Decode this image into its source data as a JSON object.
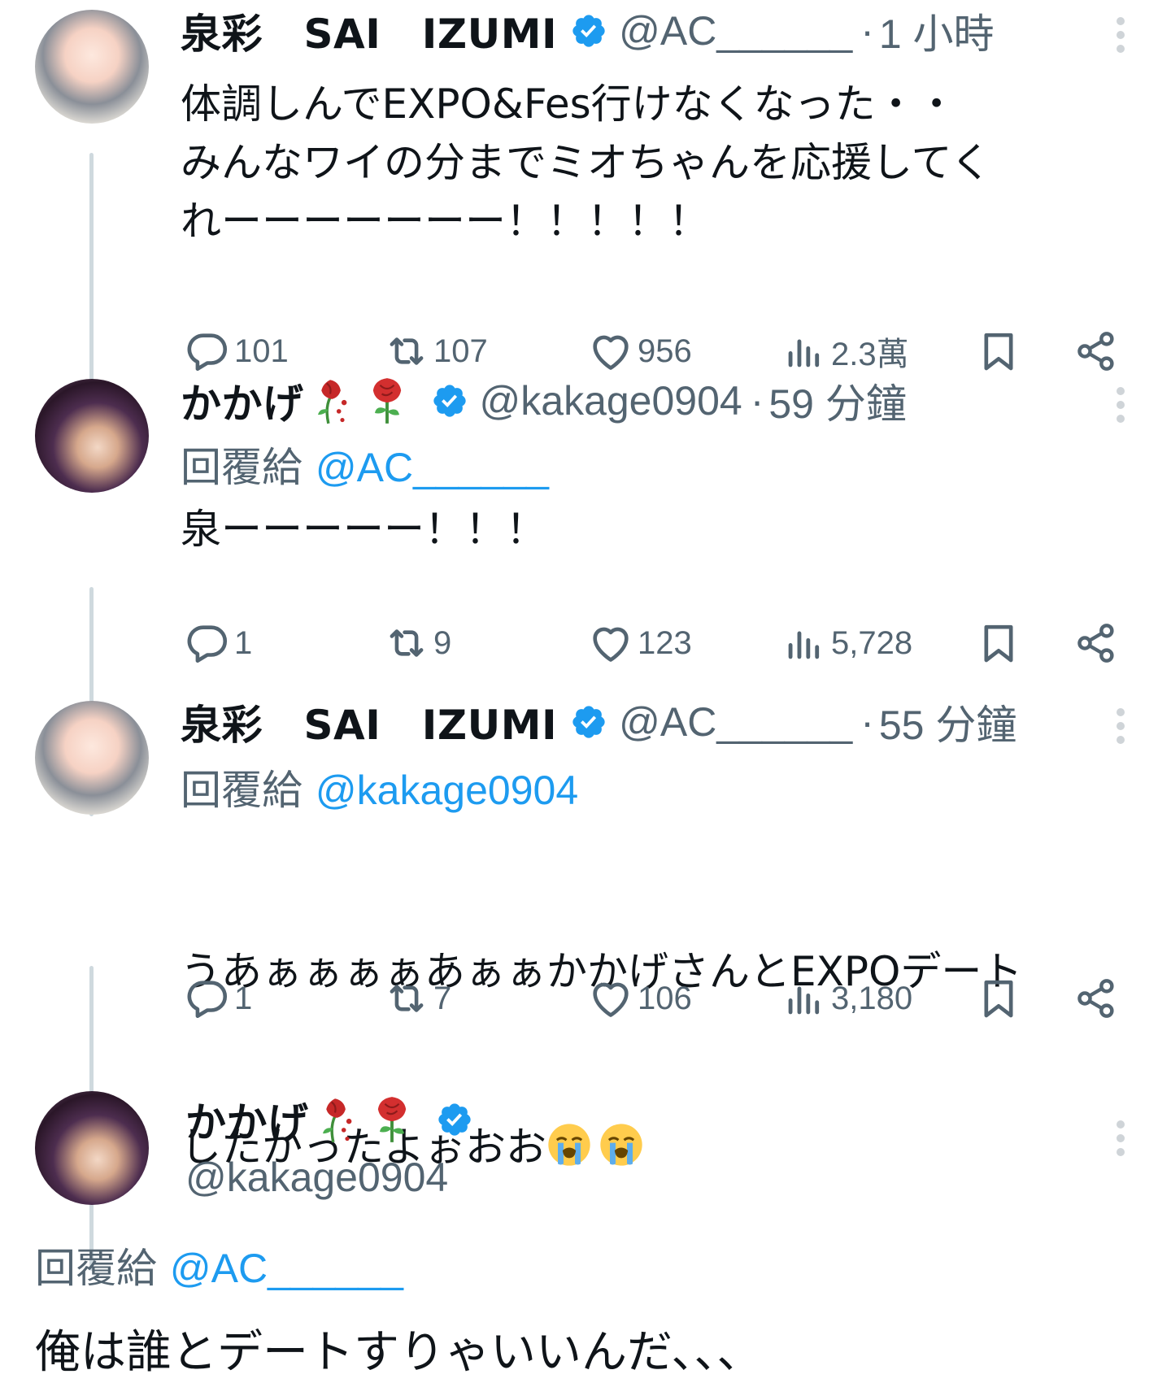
{
  "tweets": [
    {
      "author": "泉彩　SAI　IZUMI",
      "handle": "@AC______",
      "time": "1 小時",
      "text": "体調しんでEXPO&Fes行けなくなった・・\nみんなワイの分までミオちゃんを応援してく\nれーーーーーーー！！！！！",
      "replies": "101",
      "reposts": "107",
      "likes": "956",
      "views": "2.3萬"
    },
    {
      "author": "かかげ",
      "handle": "@kakage0904",
      "time": "59 分鐘",
      "reply_label": "回覆給",
      "reply_to": "@AC______",
      "text": "泉ーーーーー！！！",
      "replies": "1",
      "reposts": "9",
      "likes": "123",
      "views": "5,728"
    },
    {
      "author": "泉彩　SAI　IZUMI",
      "handle": "@AC______",
      "time": "55 分鐘",
      "reply_label": "回覆給",
      "reply_to": "@kakage0904",
      "text_line1": "うあぁぁぁぁあぁぁかかげさんとEXPOデート",
      "text_line2": "したかったよぉおお",
      "replies": "1",
      "reposts": "7",
      "likes": "106",
      "views": "3,180"
    },
    {
      "author": "かかげ",
      "handle": "@kakage0904",
      "reply_label": "回覆給",
      "reply_to": "@AC______",
      "text": "俺は誰とデートすりゃいいんだ、、、"
    }
  ],
  "icons": {
    "reply": "reply-icon",
    "repost": "repost-icon",
    "like": "like-icon",
    "views": "views-icon",
    "bookmark": "bookmark-icon",
    "share": "share-icon",
    "more": "more-icon",
    "verified": "verified-badge-icon"
  },
  "colors": {
    "accent": "#1d9bf0",
    "muted": "#536471",
    "thread_line": "#cfd9de"
  }
}
